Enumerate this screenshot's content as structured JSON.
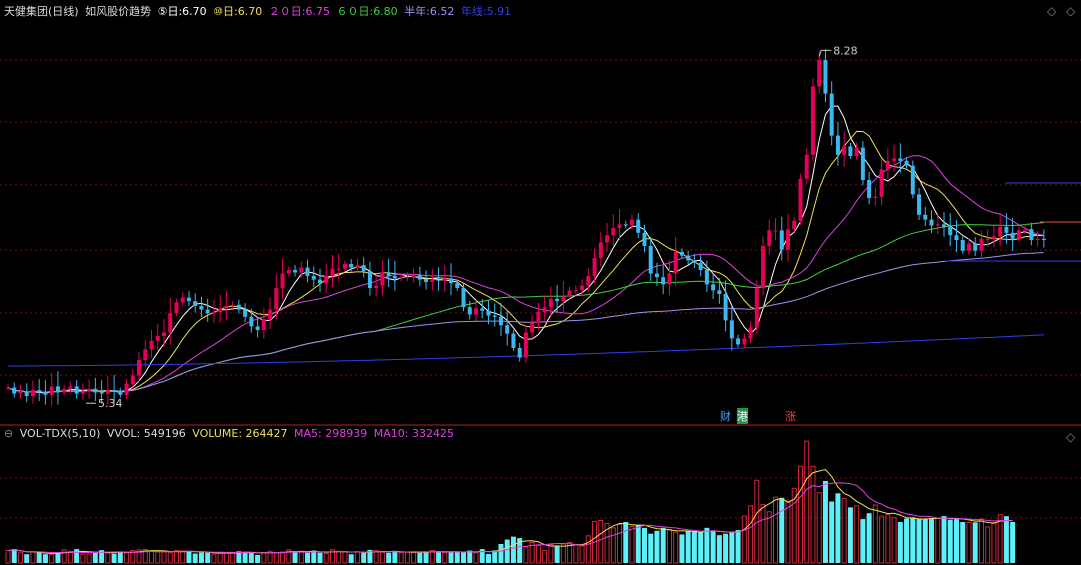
{
  "header": {
    "title": "天健集团(日线)",
    "indicator": "如风股价趋势",
    "ma5_label": "⑤日:",
    "ma5_value": "6.70",
    "ma10_label": "⑩日:",
    "ma10_value": "6.70",
    "ma20_label": "２０日:",
    "ma20_value": "6.75",
    "ma60_label": "６０日:",
    "ma60_value": "6.80",
    "half_label": "半年:",
    "half_value": "6.52",
    "year_label": "年线:",
    "year_value": "5.91"
  },
  "volume_header": {
    "name": "VOL-TDX(5,10)",
    "vvol": "VVOL: 549196",
    "volume": "VOLUME: 264427",
    "ma5": "MA5: 298939",
    "ma10": "MA10: 332425"
  },
  "annotations": {
    "high": "8.28",
    "low": "5.34"
  },
  "markers": [
    "财",
    "港",
    "涨"
  ],
  "colors": {
    "up": "#e5005a",
    "down": "#3cb8f0",
    "volume_up": "#d0283a",
    "volume_down": "#5ef0f8",
    "ma5": "#ffffff",
    "ma10": "#f0e050",
    "ma20": "#e040e0",
    "ma60": "#40d040",
    "half": "#a090f0",
    "year": "#3040e8",
    "grid": "#7a1010"
  },
  "chart_data": [
    {
      "type": "candlestick",
      "title": "天健集团(日线)",
      "ylim": [
        5.2,
        8.55
      ],
      "high_label": 8.28,
      "low_label": 5.34,
      "series": [
        {
          "name": "⑤日",
          "last": 6.7
        },
        {
          "name": "⑩日",
          "last": 6.7
        },
        {
          "name": "２０日",
          "last": 6.75
        },
        {
          "name": "６０日",
          "last": 6.8
        },
        {
          "name": "半年",
          "last": 6.52
        },
        {
          "name": "年线",
          "last": 5.91
        }
      ],
      "close": [
        5.47,
        5.42,
        5.44,
        5.4,
        5.45,
        5.43,
        5.41,
        5.48,
        5.43,
        5.46,
        5.48,
        5.42,
        5.44,
        5.46,
        5.43,
        5.42,
        5.45,
        5.44,
        5.41,
        5.5,
        5.57,
        5.7,
        5.79,
        5.86,
        5.9,
        5.93,
        6.09,
        6.18,
        6.22,
        6.19,
        6.15,
        6.12,
        6.09,
        6.1,
        6.13,
        6.15,
        6.16,
        6.12,
        6.06,
        5.98,
        5.95,
        6.04,
        6.12,
        6.3,
        6.42,
        6.45,
        6.43,
        6.47,
        6.4,
        6.37,
        6.34,
        6.4,
        6.46,
        6.46,
        6.5,
        6.47,
        6.49,
        6.44,
        6.3,
        6.32,
        6.43,
        6.4,
        6.38,
        6.39,
        6.39,
        6.41,
        6.37,
        6.35,
        6.37,
        6.36,
        6.38,
        6.34,
        6.3,
        6.14,
        6.08,
        6.13,
        6.11,
        6.07,
        6.06,
        5.99,
        5.92,
        5.8,
        5.72,
        5.93,
        6.01,
        6.1,
        6.14,
        6.21,
        6.19,
        6.23,
        6.28,
        6.28,
        6.32,
        6.4,
        6.55,
        6.68,
        6.74,
        6.8,
        6.83,
        6.82,
        6.87,
        6.76,
        6.65,
        6.42,
        6.39,
        6.33,
        6.42,
        6.6,
        6.57,
        6.53,
        6.51,
        6.45,
        6.33,
        6.28,
        6.25,
        6.03,
        5.88,
        5.83,
        5.88,
        5.97,
        6.3,
        6.65,
        6.78,
        6.78,
        6.62,
        6.79,
        6.86,
        7.21,
        7.41,
        7.98,
        8.2,
        7.92,
        7.57,
        7.41,
        7.48,
        7.4,
        7.47,
        7.2,
        7.05,
        7.06,
        7.29,
        7.36,
        7.38,
        7.36,
        7.32,
        7.08,
        6.91,
        6.87,
        6.82,
        6.83,
        6.81,
        6.74,
        6.7,
        6.61,
        6.67,
        6.61,
        6.71,
        6.71,
        6.73,
        6.81,
        6.76,
        6.71,
        6.78,
        6.79,
        6.7,
        6.71,
        6.7
      ],
      "volume": [
        85,
        95,
        70,
        60,
        75,
        72,
        60,
        58,
        70,
        90,
        80,
        95,
        60,
        60,
        75,
        88,
        70,
        65,
        72,
        70,
        85,
        90,
        92,
        80,
        75,
        75,
        70,
        85,
        82,
        80,
        65,
        72,
        70,
        60,
        72,
        70,
        68,
        80,
        76,
        70,
        55,
        72,
        80,
        70,
        75,
        90,
        75,
        80,
        70,
        85,
        70,
        65,
        90,
        80,
        78,
        60,
        75,
        70,
        90,
        85,
        74,
        70,
        80,
        72,
        75,
        72,
        70,
        76,
        85,
        80,
        70,
        75,
        74,
        76,
        85,
        70,
        95,
        62,
        86,
        130,
        160,
        180,
        170,
        110,
        140,
        120,
        85,
        125,
        114,
        130,
        140,
        124,
        116,
        186,
        284,
        290,
        270,
        240,
        265,
        280,
        250,
        260,
        240,
        200,
        220,
        240,
        230,
        210,
        195,
        216,
        218,
        210,
        240,
        220,
        190,
        200,
        210,
        225,
        320,
        390,
        565,
        400,
        350,
        450,
        445,
        424,
        510,
        660,
        832,
        660,
        480,
        560,
        420,
        476,
        440,
        380,
        390,
        300,
        340,
        396,
        320,
        330,
        310,
        280,
        304,
        312,
        300,
        304,
        300,
        308,
        320,
        296,
        300,
        280,
        276,
        278,
        300,
        246,
        270,
        330,
        320,
        280
      ]
    },
    {
      "type": "bar",
      "title": "VOL-TDX(5,10)",
      "series": [
        {
          "name": "VOLUME",
          "last": 264427
        },
        {
          "name": "MA5",
          "last": 298939
        },
        {
          "name": "MA10",
          "last": 332425
        }
      ]
    }
  ]
}
